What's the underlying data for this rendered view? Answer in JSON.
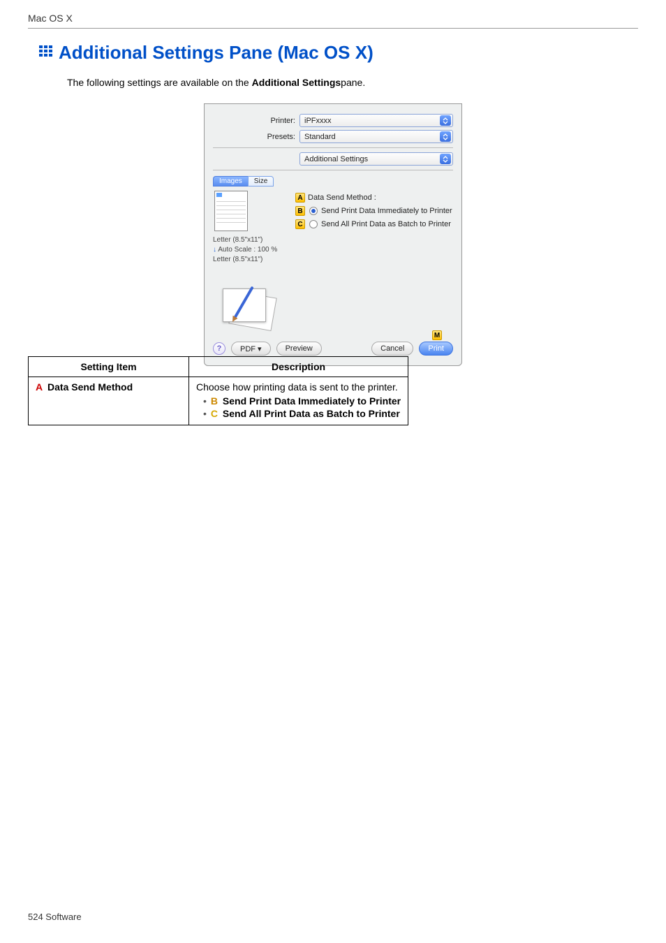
{
  "header": {
    "section": "Mac OS X"
  },
  "title": "Additional Settings Pane (Mac OS X)",
  "intro_pre": "The following settings are available on the ",
  "intro_bold": "Additional Settings",
  "intro_post": "pane.",
  "dialog": {
    "printer_label": "Printer:",
    "printer_value": "iPFxxxx",
    "presets_label": "Presets:",
    "presets_value": "Standard",
    "pane_value": "Additional Settings",
    "tab_images": "Images",
    "tab_size": "Size",
    "data_send_method_label": "Data Send Method :",
    "opt_b": "Send Print Data Immediately to Printer",
    "opt_c": "Send All Print Data as Batch to Printer",
    "paper1": "Letter (8.5\"x11\")",
    "paper2": "Auto Scale : 100 %",
    "paper3": "Letter (8.5\"x11\")",
    "pdf_btn": "PDF ▾",
    "preview_btn": "Preview",
    "cancel_btn": "Cancel",
    "print_btn": "Print",
    "marker_a": "A",
    "marker_b": "B",
    "marker_c": "C",
    "marker_m": "M",
    "help": "?"
  },
  "table": {
    "head_item": "Setting Item",
    "head_desc": "Description",
    "row1_item_letter": "A",
    "row1_item_text": "Data Send Method",
    "row1_desc_line1": "Choose how printing data is sent to the printer.",
    "row1_b_letter": "B",
    "row1_b_text": "Send Print Data Immediately to Printer",
    "row1_c_letter": "C",
    "row1_c_text": "Send All Print Data as Batch to Printer"
  },
  "footer": "524  Software"
}
